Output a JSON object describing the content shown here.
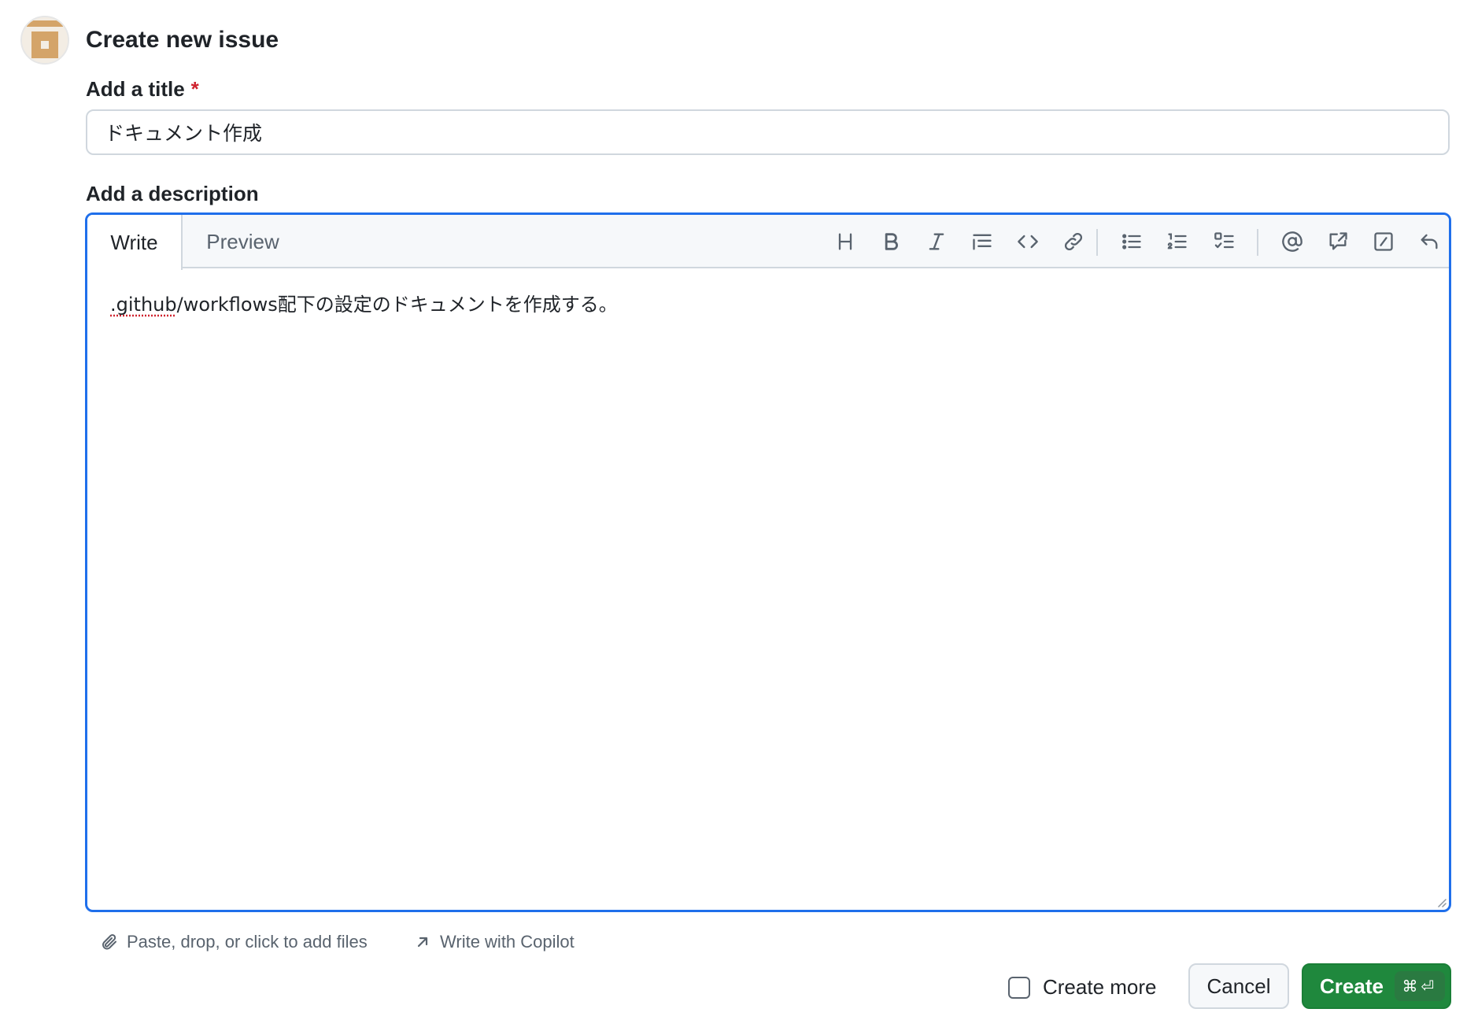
{
  "header": {
    "title": "Create new issue"
  },
  "title_field": {
    "label": "Add a title",
    "required_mark": "*",
    "value": "ドキュメント作成"
  },
  "description": {
    "label": "Add a description",
    "tabs": {
      "write": "Write",
      "preview": "Preview"
    },
    "active_tab": "Write",
    "toolbar_icons": [
      "heading-icon",
      "bold-icon",
      "italic-icon",
      "quote-icon",
      "code-icon",
      "link-icon",
      "unordered-list-icon",
      "ordered-list-icon",
      "task-list-icon",
      "mention-icon",
      "reference-icon",
      "slash-commands-icon",
      "undo-icon"
    ],
    "body_spell": ".github",
    "body_rest": "/workflows配下の設定のドキュメントを作成する。"
  },
  "footer": {
    "attach_label": "Paste, drop, or click to add files",
    "copilot_label": "Write with Copilot",
    "create_more_label": "Create more",
    "create_more_checked": false,
    "cancel_label": "Cancel",
    "create_label": "Create",
    "create_shortcut": "⌘⏎"
  },
  "colors": {
    "accent": "#1f6feb",
    "primary_button": "#1f883d",
    "required": "#cf222e",
    "avatar": "#d4a469"
  }
}
